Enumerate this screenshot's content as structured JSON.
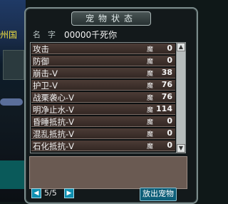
{
  "scene": {
    "text": "州国"
  },
  "window": {
    "title": "宠物状态"
  },
  "pet": {
    "name_label": "名字",
    "name": "00000千死你"
  },
  "stats": [
    {
      "label": "攻击",
      "icon": "魔",
      "value": "0"
    },
    {
      "label": "防御",
      "icon": "魔",
      "value": "0"
    },
    {
      "label": "崩击-V",
      "icon": "魔",
      "value": "38"
    },
    {
      "label": "护卫-V",
      "icon": "魔",
      "value": "76"
    },
    {
      "label": "战栗袭心-V",
      "icon": "魔",
      "value": "76"
    },
    {
      "label": "明净止水-V",
      "icon": "魔",
      "value": "114"
    },
    {
      "label": "昏睡抵抗-V",
      "icon": "魔",
      "value": "0"
    },
    {
      "label": "混乱抵抗-V",
      "icon": "魔",
      "value": "0"
    },
    {
      "label": "石化抵抗-V",
      "icon": "魔",
      "value": "0"
    }
  ],
  "pager": {
    "text": "5/5"
  },
  "buttons": {
    "release": "放出宠物",
    "prev": "◀",
    "next": "▶",
    "scroll_up": "▲",
    "scroll_down": "▼"
  }
}
